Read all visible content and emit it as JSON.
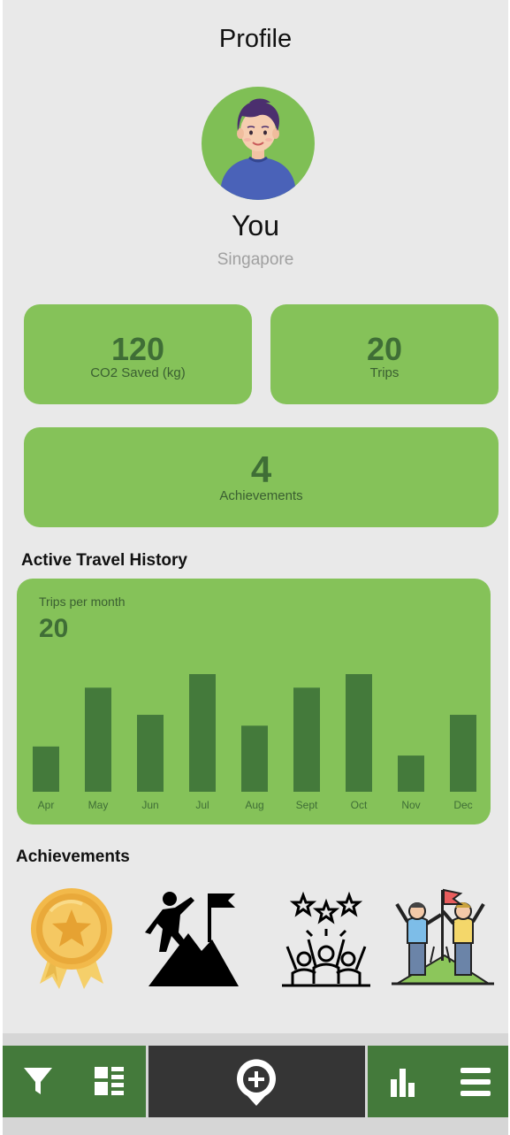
{
  "header": {
    "title": "Profile"
  },
  "profile": {
    "name": "You",
    "location": "Singapore"
  },
  "stats": {
    "co2": {
      "value": "120",
      "label": "CO2 Saved (kg)"
    },
    "trips": {
      "value": "20",
      "label": "Trips"
    },
    "achievements": {
      "value": "4",
      "label": "Achievements"
    }
  },
  "history": {
    "section_title": "Active Travel History",
    "subtitle": "Trips per month",
    "total": "20"
  },
  "chart_data": {
    "type": "bar",
    "categories": [
      "Apr",
      "May",
      "Jun",
      "Jul",
      "Aug",
      "Sept",
      "Oct",
      "Nov",
      "Dec"
    ],
    "values": [
      5,
      11.5,
      8.5,
      13,
      7.3,
      11.5,
      13,
      4,
      8.5
    ],
    "ylim": [
      0,
      13
    ],
    "color": "#447a3b"
  },
  "achievements_section": {
    "title": "Achievements",
    "icons": [
      "medal-icon",
      "climber-summit-icon",
      "celebrating-team-icon",
      "team-flag-summit-icon"
    ]
  },
  "nav": {
    "left": [
      "filter-icon",
      "layout-list-icon"
    ],
    "center": "add-location-icon",
    "right": [
      "bar-chart-icon",
      "menu-icon"
    ]
  },
  "colors": {
    "accent": "#85c259",
    "dark_green": "#447a3b",
    "nav_dark": "#353535",
    "background": "#e9e9e9"
  }
}
